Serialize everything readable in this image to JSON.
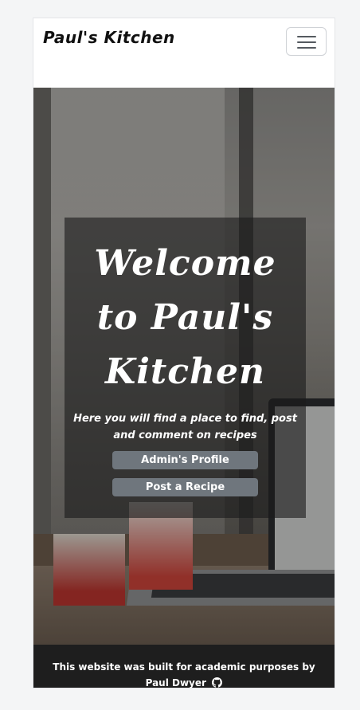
{
  "navbar": {
    "brand": "Paul's Kitchen",
    "toggler_icon": "hamburger-menu-icon"
  },
  "hero": {
    "title": "Welcome to Paul's Kitchen",
    "subtitle": "Here you will find a place to find, post and comment on recipes",
    "buttons": {
      "admin_profile": "Admin's Profile",
      "post_recipe": "Post a Recipe"
    },
    "button_color": "#6f767d"
  },
  "footer": {
    "text": "This website was built for academic purposes by Paul Dwyer",
    "icon": "github-icon",
    "background": "#1e1e1e"
  }
}
